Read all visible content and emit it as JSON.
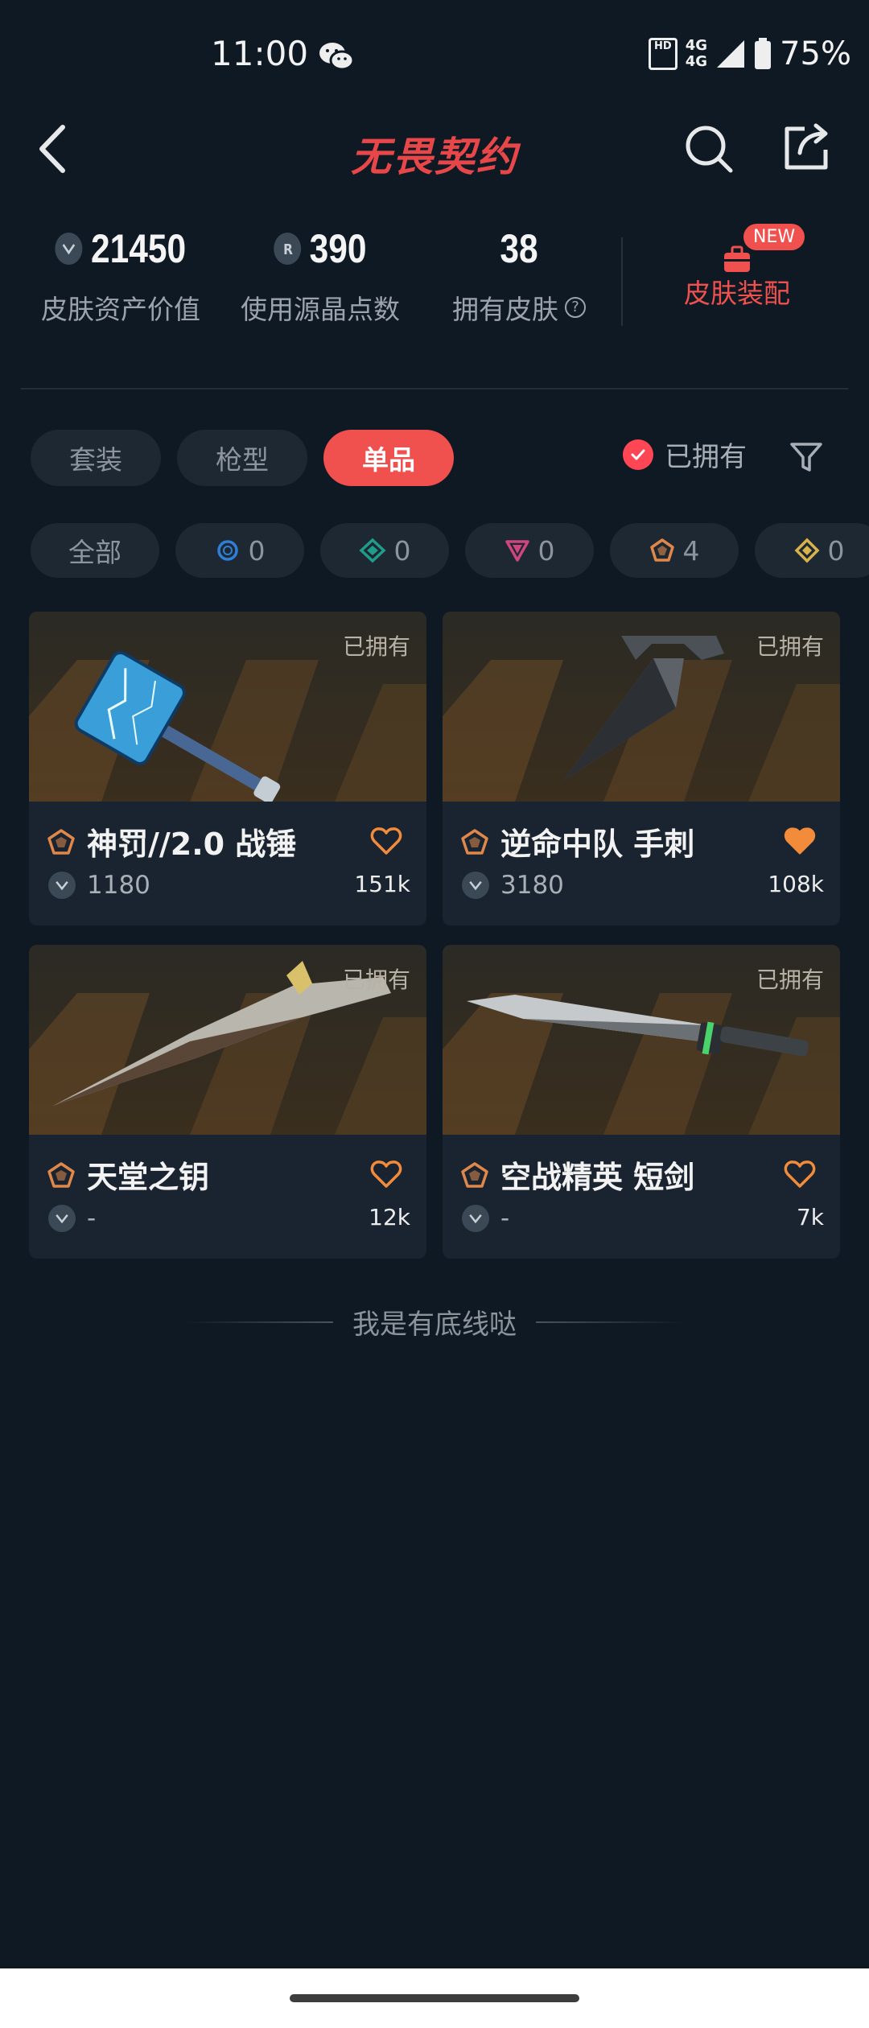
{
  "status_bar": {
    "time": "11:00",
    "network_top": "4G",
    "network_bottom": "4G",
    "hd_label": "HD",
    "battery": "75%"
  },
  "header": {
    "logo": "无畏契约",
    "icons": [
      "back-icon",
      "search-icon",
      "share-icon"
    ]
  },
  "stats": {
    "asset_value": "21450",
    "asset_label": "皮肤资产价值",
    "radianite": "390",
    "radianite_label": "使用源晶点数",
    "owned": "38",
    "owned_label": "拥有皮肤",
    "equip_badge": "NEW",
    "equip_label": "皮肤装配"
  },
  "tabs": [
    "套装",
    "枪型",
    "单品"
  ],
  "active_tab": "单品",
  "owned_filter": "已拥有",
  "rarity_filters": [
    {
      "label": "全部"
    },
    {
      "count": "0",
      "color": "#2f7fd6"
    },
    {
      "count": "0",
      "color": "#1f9c8a"
    },
    {
      "count": "0",
      "color": "#d0457e"
    },
    {
      "count": "4",
      "color": "#e0884a"
    },
    {
      "count": "0",
      "color": "#d8b24a"
    }
  ],
  "items": [
    {
      "name": "神罚//2.0 战锤",
      "price": "1180",
      "likes": "151k",
      "owned": "已拥有",
      "liked": false
    },
    {
      "name": "逆命中队 手刺",
      "price": "3180",
      "likes": "108k",
      "owned": "已拥有",
      "liked": true
    },
    {
      "name": "天堂之钥",
      "price": "-",
      "likes": "12k",
      "owned": "已拥有",
      "liked": false
    },
    {
      "name": "空战精英 短剑",
      "price": "-",
      "likes": "7k",
      "owned": "已拥有",
      "liked": false
    }
  ],
  "footer_text": "我是有底线哒",
  "colors": {
    "accent": "#f0504e",
    "background": "#0f1923",
    "card": "#1a2430",
    "tier": "#e0884a",
    "like": "#f28b3a"
  }
}
